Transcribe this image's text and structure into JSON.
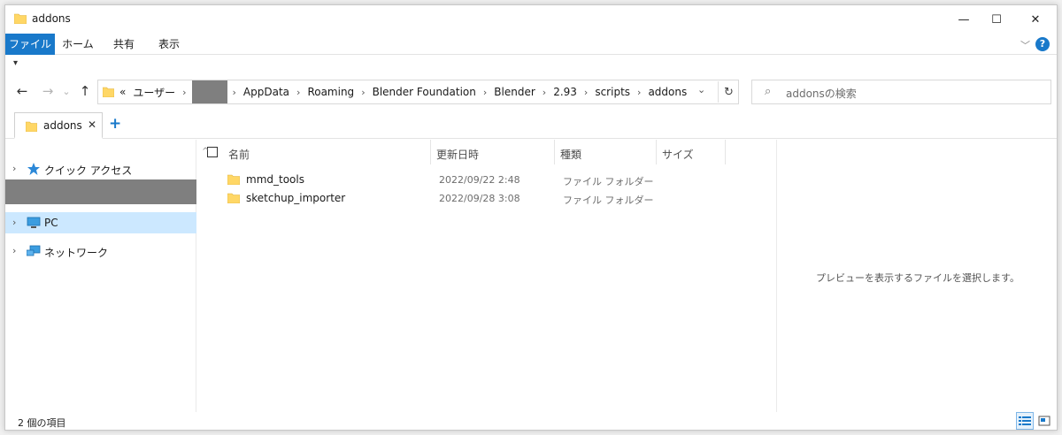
{
  "window": {
    "title": "addons",
    "controls": {
      "minimize": "—",
      "maximize": "☐",
      "close": "✕"
    }
  },
  "ribbon": {
    "tabs": [
      {
        "label": "ファイル",
        "active": true
      },
      {
        "label": "ホーム"
      },
      {
        "label": "共有"
      },
      {
        "label": "表示"
      }
    ],
    "help": "?"
  },
  "navigation": {
    "back": "←",
    "forward": "→",
    "recent": "⌄",
    "up": "↑",
    "overflow": "«",
    "breadcrumbs": [
      "ユーザー",
      "AppData",
      "Roaming",
      "Blender Foundation",
      "Blender",
      "2.93",
      "scripts",
      "addons"
    ],
    "refresh": "↻",
    "search_placeholder": "addonsの検索"
  },
  "tabs": {
    "current": {
      "label": "addons",
      "close": "✕"
    },
    "add": "+"
  },
  "nav_pane": {
    "items": [
      {
        "label": "クイック アクセス",
        "icon": "star-icon"
      },
      {
        "label": "PC",
        "icon": "pc-icon",
        "selected": true
      },
      {
        "label": "ネットワーク",
        "icon": "network-icon"
      }
    ]
  },
  "file_list": {
    "columns": [
      "名前",
      "更新日時",
      "種類",
      "サイズ"
    ],
    "rows": [
      {
        "name": "mmd_tools",
        "modified": "2022/09/22 2:48",
        "type": "ファイル フォルダー",
        "size": ""
      },
      {
        "name": "sketchup_importer",
        "modified": "2022/09/28 3:08",
        "type": "ファイル フォルダー",
        "size": ""
      }
    ]
  },
  "preview": {
    "message": "プレビューを表示するファイルを選択します。"
  },
  "status": {
    "item_count": "2 個の項目"
  },
  "colors": {
    "accent": "#1979ca",
    "selection": "#cce8ff",
    "folder": "#ffd766",
    "redaction": "#7f7f7f"
  }
}
